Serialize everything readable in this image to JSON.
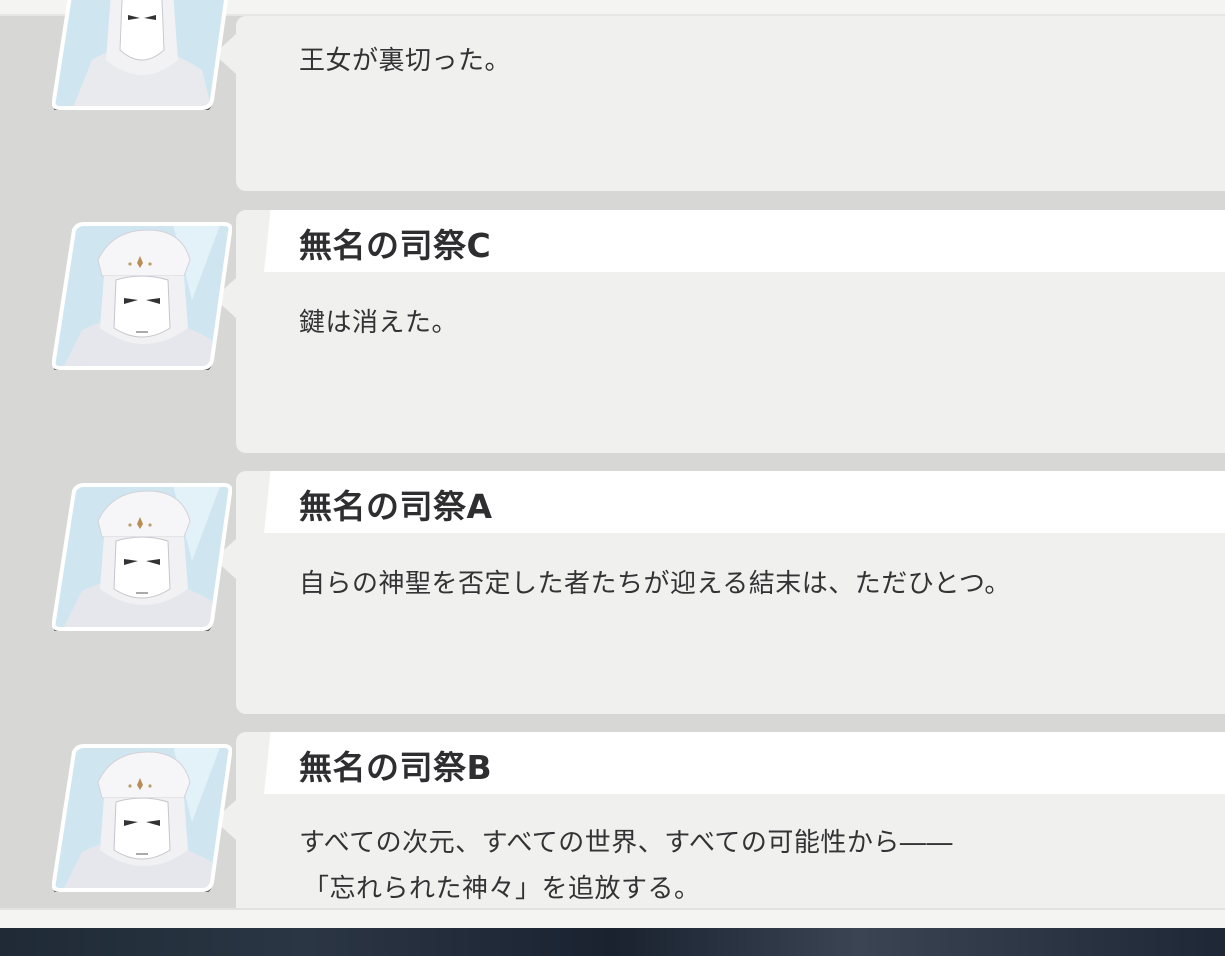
{
  "log_entries": [
    {
      "speaker": "",
      "lines": [
        "王女が裏切った。"
      ],
      "portrait_icon": "masked-priest-portrait-icon"
    },
    {
      "speaker": "無名の司祭C",
      "lines": [
        "鍵は消えた。"
      ],
      "portrait_icon": "masked-priest-portrait-icon"
    },
    {
      "speaker": "無名の司祭A",
      "lines": [
        "自らの神聖を否定した者たちが迎える結末は、ただひとつ。"
      ],
      "portrait_icon": "masked-priest-portrait-icon"
    },
    {
      "speaker": "無名の司祭B",
      "lines": [
        "すべての次元、すべての世界、すべての可能性から――",
        "「忘れられた神々」を追放する。"
      ],
      "portrait_icon": "masked-priest-portrait-icon"
    }
  ],
  "colors": {
    "background": "#d7d7d5",
    "card": "#f0f0ef",
    "namebar": "#ffffff",
    "text": "#333335"
  }
}
